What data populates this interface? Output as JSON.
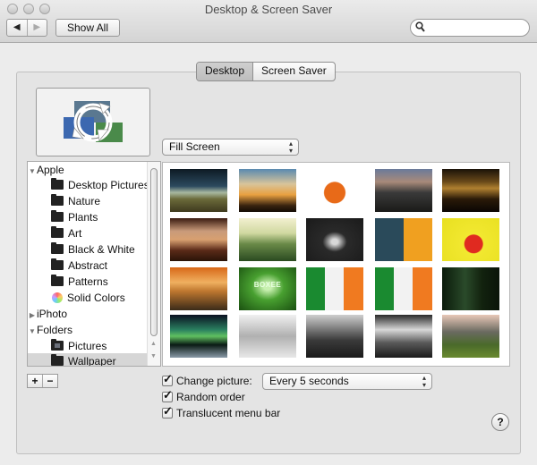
{
  "window": {
    "title": "Desktop & Screen Saver",
    "traffic_lights": [
      "close",
      "minimize",
      "zoom"
    ]
  },
  "toolbar": {
    "back_icon": "back-arrow-icon",
    "forward_icon": "forward-arrow-icon",
    "back_glyph": "◀",
    "forward_glyph": "▶",
    "show_all_label": "Show All",
    "search_value": "",
    "search_icon_glyph": "🔍"
  },
  "tabs": [
    {
      "label": "Desktop",
      "active": true
    },
    {
      "label": "Screen Saver",
      "active": false
    }
  ],
  "preview": {
    "icon": "rotating-pictures-icon"
  },
  "fit_select": {
    "value": "Fill Screen",
    "arrows": "▲▼"
  },
  "sources": [
    {
      "label": "Apple",
      "type": "group",
      "expanded": true,
      "disclosure": "▼"
    },
    {
      "label": "Desktop Pictures",
      "type": "folder"
    },
    {
      "label": "Nature",
      "type": "folder"
    },
    {
      "label": "Plants",
      "type": "folder"
    },
    {
      "label": "Art",
      "type": "folder"
    },
    {
      "label": "Black & White",
      "type": "folder"
    },
    {
      "label": "Abstract",
      "type": "folder"
    },
    {
      "label": "Patterns",
      "type": "folder"
    },
    {
      "label": "Solid Colors",
      "type": "colors"
    },
    {
      "label": "iPhoto",
      "type": "group",
      "expanded": false,
      "disclosure": "▶"
    },
    {
      "label": "Folders",
      "type": "group",
      "expanded": true,
      "disclosure": "▼"
    },
    {
      "label": "Pictures",
      "type": "pictures-folder"
    },
    {
      "label": "Wallpaper",
      "type": "folder",
      "selected": true
    }
  ],
  "list_buttons": {
    "add": "+",
    "remove": "−"
  },
  "thumbnails": [
    {
      "name": "stormy-field",
      "bg": "linear-gradient(#0d1a24 0%, #2c4a5e 40%, #a8b8a0 55%, #6b6a3a 70%, #3e3a1e 100%)"
    },
    {
      "name": "tree-silhouette-sunset",
      "bg": "linear-gradient(#5a8ab0 0%, #d8c49a 35%, #e8a040 60%, #3a2410 85%, #120a04 100%)"
    },
    {
      "name": "orange-tree-art",
      "bg": "radial-gradient(circle at 50% 55%, #e86a18 0 28%, #ffffff 30%)"
    },
    {
      "name": "dusk-castle",
      "bg": "linear-gradient(#6a7a9a 0%, #a88a7a 30%, #3a3a3a 55%, #1a1a18 100%)"
    },
    {
      "name": "night-city-reflection",
      "bg": "linear-gradient(#1a1208 0%, #6a4a1a 30%, #b08030 45%, #2a1a08 70%, #0a0604 100%)"
    },
    {
      "name": "tractor-sunset",
      "bg": "linear-gradient(#3a1a10 0%, #c89a7a 30%, #d8a070 50%, #5a2a18 75%, #2a1408 100%)"
    },
    {
      "name": "green-hill-tree",
      "bg": "linear-gradient(#f2f0d0 0%, #d0d8a0 35%, #6a8a48 60%, #2a4a20 100%)"
    },
    {
      "name": "dragonfly-dark",
      "bg": "radial-gradient(ellipse at 50% 55%, #d8d8d8 0 8%, #2a2a2a 30%, #1a1a1a 100%)"
    },
    {
      "name": "day-night-split",
      "bg": "linear-gradient(90deg, #2a4a5a 0 50%, #f0a020 50% 100%)"
    },
    {
      "name": "yellow-smileys-red",
      "bg": "radial-gradient(circle at 55% 60%, #e02a20 0 22%, #f2e830 24%, #e8e020 100%)"
    },
    {
      "name": "orange-lake-lights",
      "bg": "linear-gradient(#d86818 0%, #f0b060 35%, #c07830 55%, #3a2a18 100%)"
    },
    {
      "name": "boxee-green",
      "bg": "radial-gradient(ellipse at 50% 45%, #c8f0b0 0 10%, #48a030 40%, #1a5010 100%)",
      "label": "BOXEE"
    },
    {
      "name": "irish-flag-1",
      "bg": "linear-gradient(90deg, #1a8a30 0 33%, #f2f2f2 33% 66%, #f07a20 66% 100%)"
    },
    {
      "name": "irish-flag-2",
      "bg": "linear-gradient(90deg, #1a8a30 0 33%, #f2f2f2 33% 66%, #f07a20 66% 100%)"
    },
    {
      "name": "dark-forest",
      "bg": "linear-gradient(90deg, #0a1a0a 0%, #2a4a2a 40%, #12220e 70%, #0a140a 100%)"
    },
    {
      "name": "aurora-night",
      "bg": "linear-gradient(#0a1020 0%, #2a8060 35%, #60c060 50%, #0a1a14 70%, #8a9aa8 100%)"
    },
    {
      "name": "snowy-trees",
      "bg": "linear-gradient(#f0f0f0 0%, #b0b0b0 50%, #e8e8e8 100%)"
    },
    {
      "name": "bw-field-clouds",
      "bg": "linear-gradient(#cfcfcf 0%, #6a6a6a 40%, #3a3a3a 60%, #1a1a1a 100%)"
    },
    {
      "name": "bw-tree-landscape",
      "bg": "linear-gradient(#2a2a2a 0%, #d8d8d8 35%, #5a5a5a 65%, #1a1a1a 100%)"
    },
    {
      "name": "mountain-cabin",
      "bg": "linear-gradient(#e8c8b8 0%, #6a6a60 40%, #4a6a2a 70%, #6a8a30 100%)"
    }
  ],
  "options": {
    "change_picture": {
      "label": "Change picture:",
      "checked": true
    },
    "interval_select": {
      "value": "Every 5 seconds",
      "arrows": "▲▼"
    },
    "random_order": {
      "label": "Random order",
      "checked": true
    },
    "translucent_menu_bar": {
      "label": "Translucent menu bar",
      "checked": true
    }
  },
  "help": {
    "glyph": "?"
  }
}
